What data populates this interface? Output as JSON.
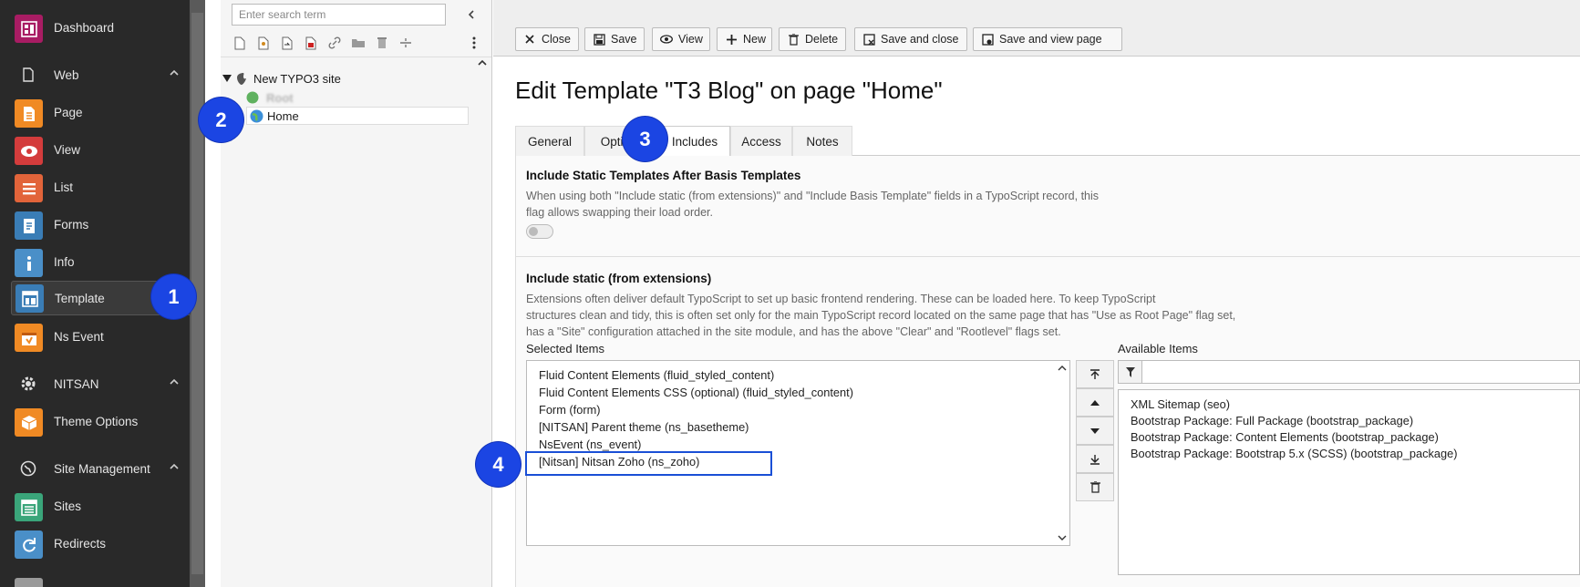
{
  "sidebar": {
    "items": [
      {
        "label": "Dashboard",
        "icon": "dashboard-icon",
        "color": "#a81c63"
      },
      {
        "label": "Page",
        "icon": "page-icon",
        "color": "#f08a24"
      },
      {
        "label": "View",
        "icon": "view-icon",
        "color": "#d43c3c"
      },
      {
        "label": "List",
        "icon": "list-icon",
        "color": "#e2643a"
      },
      {
        "label": "Forms",
        "icon": "forms-icon",
        "color": "#3a7db6"
      },
      {
        "label": "Info",
        "icon": "info-icon",
        "color": "#4a8fc8"
      },
      {
        "label": "Template",
        "icon": "template-icon",
        "color": "#3a7db6"
      },
      {
        "label": "Ns Event",
        "icon": "ns-event-icon",
        "color": "#f08a24"
      },
      {
        "label": "Theme Options",
        "icon": "theme-options-icon",
        "color": "#f08a24"
      },
      {
        "label": "Sites",
        "icon": "sites-icon",
        "color": "#3aa57a"
      },
      {
        "label": "Redirects",
        "icon": "redirects-icon",
        "color": "#4a8fc8"
      }
    ],
    "groups": {
      "web": "Web",
      "nitsan": "NITSAN",
      "site_management": "Site Management"
    }
  },
  "tree": {
    "search_placeholder": "Enter search term",
    "site_label": "New TYPO3 site",
    "root_label": "Root",
    "home_label": "Home"
  },
  "toolbar": {
    "close": "Close",
    "save": "Save",
    "view": "View",
    "new": "New",
    "delete": "Delete",
    "save_close": "Save and close",
    "save_view": "Save and view page"
  },
  "main": {
    "title": "Edit Template \"T3 Blog\" on page \"Home\"",
    "tabs": [
      "General",
      "Options",
      "Includes",
      "Access",
      "Notes"
    ],
    "section1": {
      "title": "Include Static Templates After Basis Templates",
      "desc1": "When using both \"Include static (from extensions)\" and \"Include Basis Template\" fields in a TypoScript record, this",
      "desc2": "flag allows swapping their load order."
    },
    "section2": {
      "title": "Include static (from extensions)",
      "desc1": "Extensions often deliver default TypoScript to set up basic frontend rendering. These can be loaded here. To keep TypoScript",
      "desc2": "structures clean and tidy, this is often set only for the main TypoScript record located on the same page that has \"Use as Root Page\" flag set,",
      "desc3": "has a \"Site\" configuration attached in the site module, and has the above \"Clear\" and \"Rootlevel\" flags set."
    },
    "selected_label": "Selected Items",
    "available_label": "Available Items",
    "selected_items": [
      "Fluid Content Elements (fluid_styled_content)",
      "Fluid Content Elements CSS (optional) (fluid_styled_content)",
      "Form (form)",
      "[NITSAN] Parent theme (ns_basetheme)",
      "NsEvent (ns_event)",
      "[Nitsan] Nitsan Zoho (ns_zoho)"
    ],
    "available_items": [
      "XML Sitemap (seo)",
      "Bootstrap Package: Full Package (bootstrap_package)",
      "Bootstrap Package: Content Elements (bootstrap_package)",
      "Bootstrap Package: Bootstrap 5.x (SCSS) (bootstrap_package)"
    ]
  },
  "callouts": [
    "1",
    "2",
    "3",
    "4"
  ]
}
